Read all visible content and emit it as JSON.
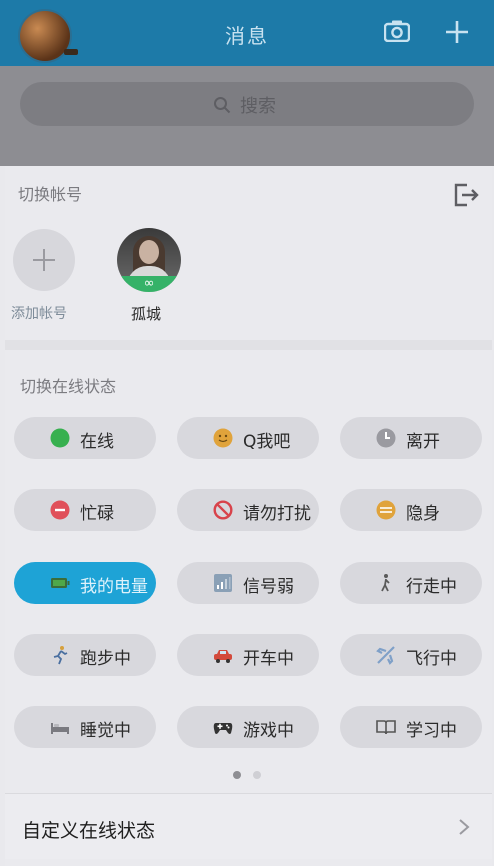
{
  "header": {
    "title": "消息",
    "camera_icon": "camera-icon",
    "add_icon": "plus-icon"
  },
  "background": {
    "search_placeholder": "搜索"
  },
  "accounts": {
    "section_label": "切换帐号",
    "logout_icon": "logout-icon",
    "add_label": "添加帐号",
    "current_name": "孤城",
    "current_badge": "∞"
  },
  "status": {
    "section_label": "切换在线状态",
    "items": [
      {
        "label": "在线",
        "icon": "green-dot",
        "color": "#37b04f",
        "active": false
      },
      {
        "label": "Q我吧",
        "icon": "smile-face",
        "color": "#e0a33b",
        "active": false
      },
      {
        "label": "离开",
        "icon": "clock",
        "color": "#9a9aa0",
        "active": false
      },
      {
        "label": "忙碌",
        "icon": "minus-circle",
        "color": "#e0505a",
        "active": false
      },
      {
        "label": "请勿打扰",
        "icon": "no-entry",
        "color": "#d8434b",
        "active": false
      },
      {
        "label": "隐身",
        "icon": "hidden-circle",
        "color": "#e0a33b",
        "active": false
      },
      {
        "label": "我的电量",
        "icon": "battery",
        "color": "#4fa84a",
        "active": true
      },
      {
        "label": "信号弱",
        "icon": "signal",
        "color": "#5a7b98",
        "active": false
      },
      {
        "label": "行走中",
        "icon": "walking",
        "color": "#5a5a5a",
        "active": false
      },
      {
        "label": "跑步中",
        "icon": "running",
        "color": "#d6a03c",
        "active": false
      },
      {
        "label": "开车中",
        "icon": "car",
        "color": "#d34a3c",
        "active": false
      },
      {
        "label": "飞行中",
        "icon": "airplane",
        "color": "#7fa0c8",
        "active": false
      },
      {
        "label": "睡觉中",
        "icon": "bed",
        "color": "#7a7a80",
        "active": false
      },
      {
        "label": "游戏中",
        "icon": "gamepad",
        "color": "#333333",
        "active": false
      },
      {
        "label": "学习中",
        "icon": "book",
        "color": "#555555",
        "active": false
      }
    ],
    "page_count": 2,
    "current_page": 1
  },
  "custom": {
    "label": "自定义在线状态"
  }
}
